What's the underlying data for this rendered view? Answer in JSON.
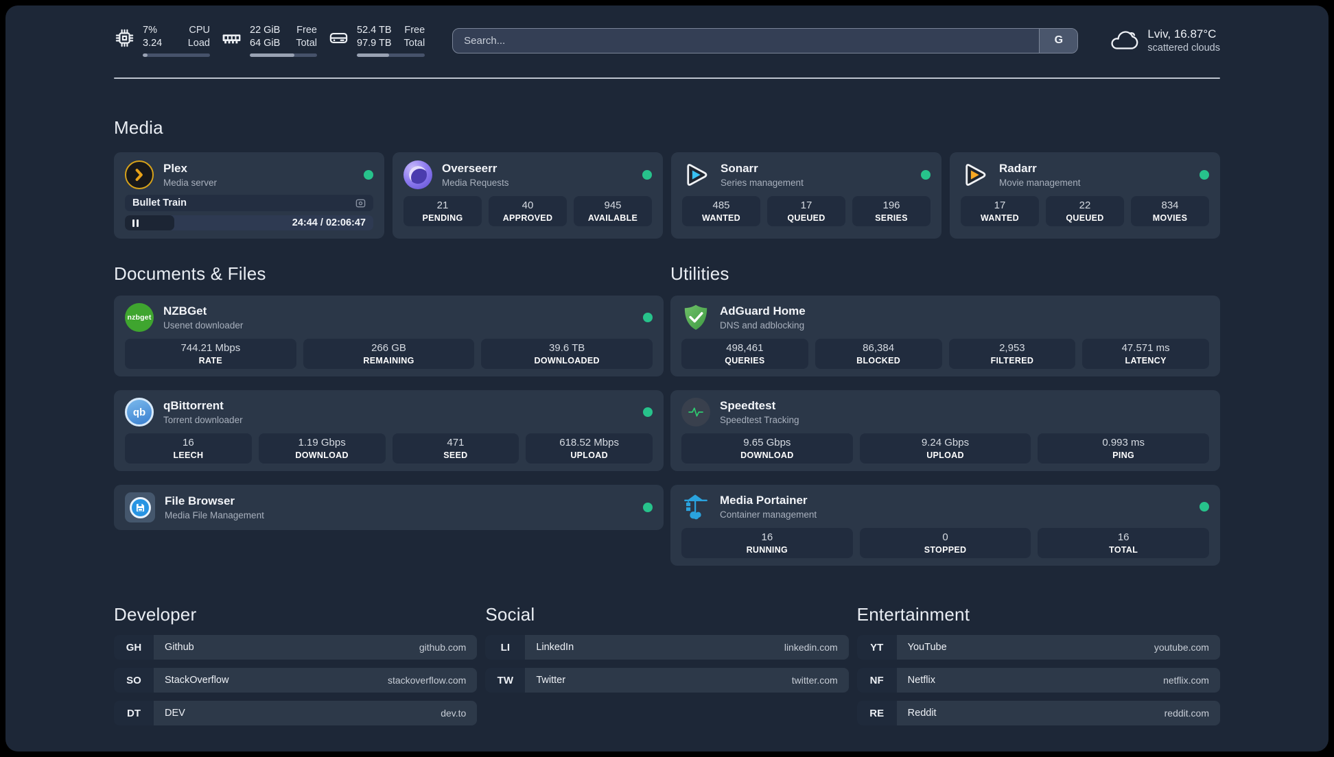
{
  "theme": {
    "background": "#1d2737",
    "card": "#2b3748",
    "tile": "#212c3e",
    "status_online": "#27c28b",
    "divider": "#ccd3dc",
    "green_accent": "#2ecc71",
    "plex_orange": "#e8a117",
    "sonarr_blue": "#38c1f2",
    "radarr_orange": "#f7a823",
    "portainer_blue": "#2aa3de"
  },
  "header": {
    "system_stats": [
      {
        "icon": "cpu-icon",
        "values": [
          "7%",
          "3.24"
        ],
        "labels": [
          "CPU",
          "Load"
        ],
        "progress_pct": 7
      },
      {
        "icon": "ram-icon",
        "values": [
          "22 GiB",
          "64 GiB"
        ],
        "labels": [
          "Free",
          "Total"
        ],
        "progress_pct": 66
      },
      {
        "icon": "disk-icon",
        "values": [
          "52.4 TB",
          "97.9 TB"
        ],
        "labels": [
          "Free",
          "Total"
        ],
        "progress_pct": 47
      }
    ],
    "search": {
      "placeholder": "Search...",
      "provider_label": "G"
    },
    "weather": {
      "icon": "cloud-icon",
      "location_temp": "Lviv, 16.87°C",
      "condition": "scattered clouds"
    }
  },
  "sections": {
    "media": {
      "title": "Media",
      "apps": [
        {
          "name": "Plex",
          "description": "Media server",
          "online": true,
          "icon": "plex-icon",
          "player": {
            "now_playing": "Bullet Train",
            "state": "paused",
            "time": "24:44 / 02:06:47",
            "progress_pct": 20
          }
        },
        {
          "name": "Overseerr",
          "description": "Media Requests",
          "online": true,
          "icon": "overseerr-icon",
          "stats": [
            {
              "value": "21",
              "label": "PENDING"
            },
            {
              "value": "40",
              "label": "APPROVED"
            },
            {
              "value": "945",
              "label": "AVAILABLE"
            }
          ]
        },
        {
          "name": "Sonarr",
          "description": "Series management",
          "online": true,
          "icon": "sonarr-icon",
          "stats": [
            {
              "value": "485",
              "label": "WANTED"
            },
            {
              "value": "17",
              "label": "QUEUED"
            },
            {
              "value": "196",
              "label": "SERIES"
            }
          ]
        },
        {
          "name": "Radarr",
          "description": "Movie management",
          "online": true,
          "icon": "radarr-icon",
          "stats": [
            {
              "value": "17",
              "label": "WANTED"
            },
            {
              "value": "22",
              "label": "QUEUED"
            },
            {
              "value": "834",
              "label": "MOVIES"
            }
          ]
        }
      ]
    },
    "documents": {
      "title": "Documents & Files",
      "apps": [
        {
          "name": "NZBGet",
          "description": "Usenet downloader",
          "online": true,
          "icon": "nzbget-icon",
          "stats": [
            {
              "value": "744.21 Mbps",
              "label": "RATE"
            },
            {
              "value": "266 GB",
              "label": "REMAINING"
            },
            {
              "value": "39.6 TB",
              "label": "DOWNLOADED"
            }
          ]
        },
        {
          "name": "qBittorrent",
          "description": "Torrent downloader",
          "online": true,
          "icon": "qbittorrent-icon",
          "stats": [
            {
              "value": "16",
              "label": "LEECH"
            },
            {
              "value": "1.19 Gbps",
              "label": "DOWNLOAD"
            },
            {
              "value": "471",
              "label": "SEED"
            },
            {
              "value": "618.52 Mbps",
              "label": "UPLOAD"
            }
          ]
        },
        {
          "name": "File Browser",
          "description": "Media File Management",
          "online": true,
          "icon": "filebrowser-icon"
        }
      ]
    },
    "utilities": {
      "title": "Utilities",
      "apps": [
        {
          "name": "AdGuard Home",
          "description": "DNS and adblocking",
          "icon": "adguard-icon",
          "stats": [
            {
              "value": "498,461",
              "label": "QUERIES"
            },
            {
              "value": "86,384",
              "label": "BLOCKED"
            },
            {
              "value": "2,953",
              "label": "FILTERED"
            },
            {
              "value": "47.571 ms",
              "label": "LATENCY"
            }
          ]
        },
        {
          "name": "Speedtest",
          "description": "Speedtest Tracking",
          "icon": "speedtest-icon",
          "stats": [
            {
              "value": "9.65 Gbps",
              "label": "DOWNLOAD"
            },
            {
              "value": "9.24 Gbps",
              "label": "UPLOAD"
            },
            {
              "value": "0.993 ms",
              "label": "PING"
            }
          ]
        },
        {
          "name": "Media Portainer",
          "description": "Container management",
          "online": true,
          "icon": "portainer-icon",
          "stats": [
            {
              "value": "16",
              "label": "RUNNING"
            },
            {
              "value": "0",
              "label": "STOPPED"
            },
            {
              "value": "16",
              "label": "TOTAL"
            }
          ]
        }
      ]
    },
    "bookmarks": [
      {
        "title": "Developer",
        "links": [
          {
            "abbr": "GH",
            "name": "Github",
            "url": "github.com"
          },
          {
            "abbr": "SO",
            "name": "StackOverflow",
            "url": "stackoverflow.com"
          },
          {
            "abbr": "DT",
            "name": "DEV",
            "url": "dev.to"
          }
        ]
      },
      {
        "title": "Social",
        "links": [
          {
            "abbr": "LI",
            "name": "LinkedIn",
            "url": "linkedin.com"
          },
          {
            "abbr": "TW",
            "name": "Twitter",
            "url": "twitter.com"
          }
        ]
      },
      {
        "title": "Entertainment",
        "links": [
          {
            "abbr": "YT",
            "name": "YouTube",
            "url": "youtube.com"
          },
          {
            "abbr": "NF",
            "name": "Netflix",
            "url": "netflix.com"
          },
          {
            "abbr": "RE",
            "name": "Reddit",
            "url": "reddit.com"
          }
        ]
      }
    ]
  },
  "icons": {
    "nzbget_text": "nzbget",
    "qbittorrent_text": "qb"
  }
}
